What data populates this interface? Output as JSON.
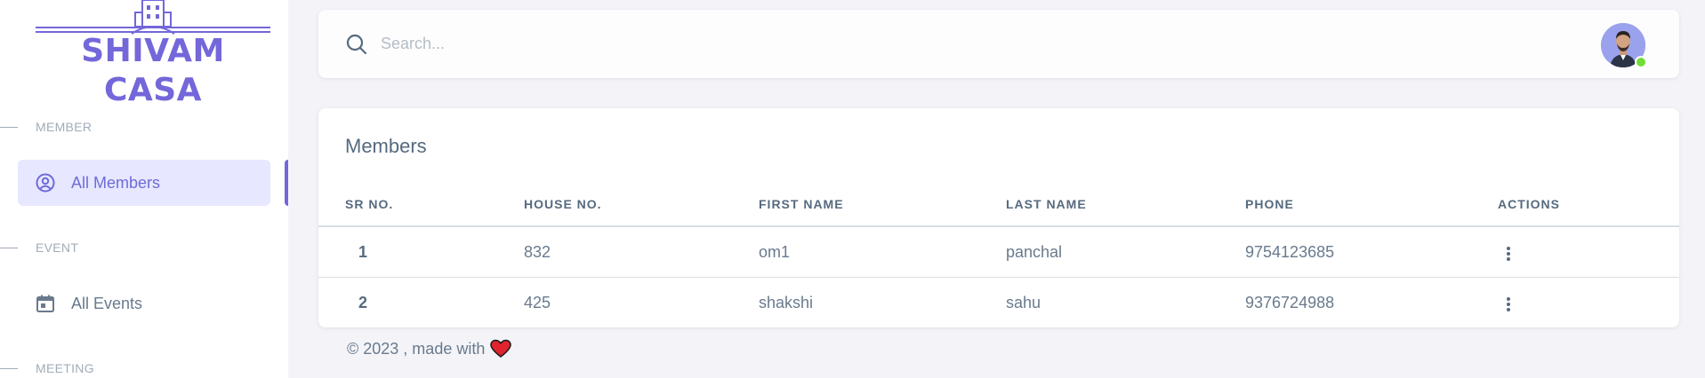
{
  "brand": {
    "name": "SHIVAM CASA",
    "accent": "#7367d9"
  },
  "sidebar": {
    "sections": [
      {
        "header": "MEMBER",
        "items": [
          {
            "label": "All Members",
            "icon": "user-circle-icon",
            "active": true
          }
        ]
      },
      {
        "header": "EVENT",
        "items": [
          {
            "label": "All Events",
            "icon": "calendar-icon",
            "active": false
          }
        ]
      },
      {
        "header": "MEETING",
        "items": []
      }
    ]
  },
  "navbar": {
    "search": {
      "placeholder": "Search...",
      "value": ""
    },
    "avatar": {
      "icon": "user-avatar",
      "status": "online",
      "status_color": "#71dd37"
    }
  },
  "members_card": {
    "title": "Members",
    "columns": [
      "SR NO.",
      "HOUSE NO.",
      "FIRST NAME",
      "LAST NAME",
      "PHONE",
      "ACTIONS"
    ],
    "rows": [
      {
        "sr": "1",
        "house": "832",
        "first": "om1",
        "last": "panchal",
        "phone": "9754123685"
      },
      {
        "sr": "2",
        "house": "425",
        "first": "shakshi",
        "last": "sahu",
        "phone": "9376724988"
      }
    ]
  },
  "footer": {
    "text": "© 2023 , made with",
    "icon": "heart-icon"
  }
}
